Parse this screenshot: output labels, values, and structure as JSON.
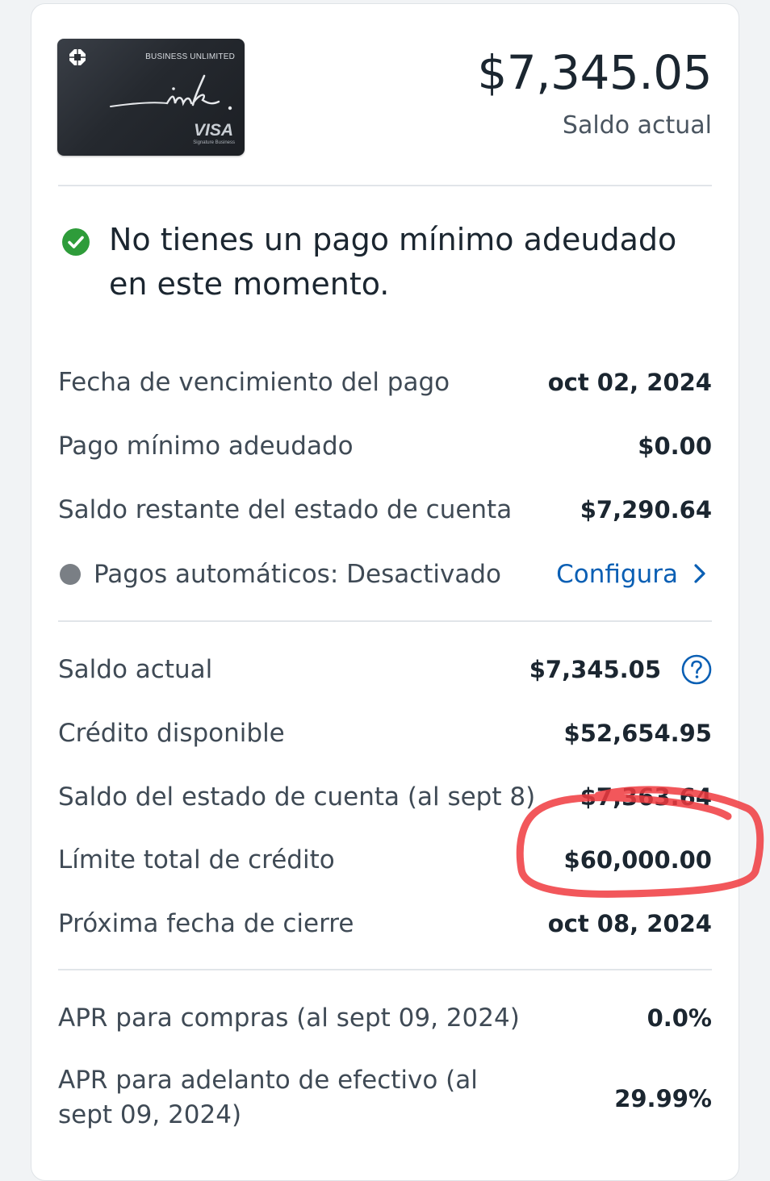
{
  "card": {
    "brand_line": "BUSINESS UNLIMITED",
    "network": "VISA",
    "network_sub": "Signature Business",
    "bank_logo_icon": "bank-octagon-logo-icon",
    "script_wordmark": "ink"
  },
  "summary": {
    "current_balance": "$7,345.05",
    "current_balance_label": "Saldo actual"
  },
  "status": {
    "icon": "check-circle-icon",
    "icon_color": "#2e9c3a",
    "message": "No tienes un pago mínimo adeudado en este momento."
  },
  "payment": {
    "rows": [
      {
        "label": "Fecha de vencimiento del pago",
        "value": "oct 02, 2024"
      },
      {
        "label": "Pago mínimo adeudado",
        "value": "$0.00"
      },
      {
        "label": "Saldo restante del estado de cuenta",
        "value": "$7,290.64"
      }
    ],
    "autopay": {
      "label": "Pagos automáticos: Desactivado",
      "action_label": "Configura",
      "dot_color": "#7a7f85",
      "action_color": "#0a5fb4"
    }
  },
  "account": {
    "rows": [
      {
        "label": "Saldo actual",
        "value": "$7,345.05",
        "help_icon": "question-circle-icon"
      },
      {
        "label": "Crédito disponible",
        "value": "$52,654.95"
      },
      {
        "label": "Saldo del estado de cuenta (al sept 8)",
        "value": "$7,363.64"
      },
      {
        "label": "Límite total de crédito",
        "value": "$60,000.00"
      },
      {
        "label": "Próxima fecha de cierre",
        "value": "oct 08, 2024"
      }
    ]
  },
  "apr": {
    "rows": [
      {
        "label": "APR para compras (al sept 09, 2024)",
        "value": "0.0%"
      },
      {
        "label": "APR para adelanto de efectivo (al sept 09, 2024)",
        "value": "29.99%"
      }
    ]
  },
  "annotation": {
    "type": "hand-drawn-circle",
    "color": "#f03a3e"
  }
}
